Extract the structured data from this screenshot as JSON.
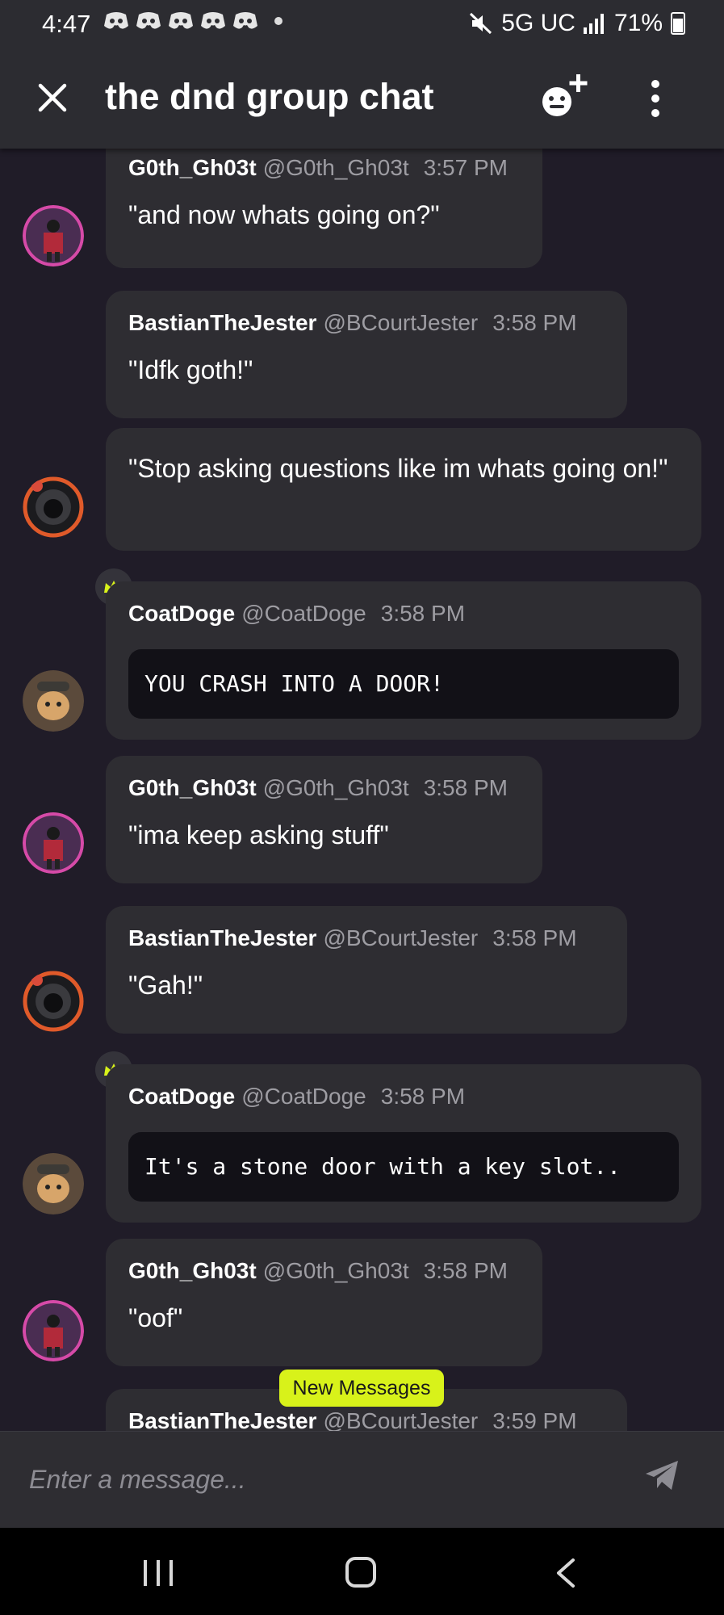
{
  "status_bar": {
    "time": "4:47",
    "network": "5G UC",
    "battery": "71%"
  },
  "header": {
    "title": "the dnd group chat"
  },
  "messages": [
    {
      "name": "G0th_Gh03t",
      "handle": "@G0th_Gh03t",
      "time": "3:57 PM",
      "text": "\"and now whats going on?\""
    },
    {
      "name": "BastianTheJester",
      "handle": "@BCourtJester",
      "time": "3:58 PM",
      "text": "\"Idfk goth!\""
    },
    {
      "text": "\"Stop asking questions like im whats going on!\""
    },
    {
      "name": "CoatDoge",
      "handle": "@CoatDoge",
      "time": "3:58 PM",
      "code": "YOU CRASH INTO A DOOR!"
    },
    {
      "name": "G0th_Gh03t",
      "handle": "@G0th_Gh03t",
      "time": "3:58 PM",
      "text": "\"ima keep asking stuff\""
    },
    {
      "name": "BastianTheJester",
      "handle": "@BCourtJester",
      "time": "3:58 PM",
      "text": "\"Gah!\""
    },
    {
      "name": "CoatDoge",
      "handle": "@CoatDoge",
      "time": "3:58 PM",
      "code": "It's a stone door with a key slot.."
    },
    {
      "name": "G0th_Gh03t",
      "handle": "@G0th_Gh03t",
      "time": "3:58 PM",
      "text": "\"oof\""
    },
    {
      "name": "BastianTheJester",
      "handle": "@BCourtJester",
      "time": "3:59 PM"
    }
  ],
  "new_messages_label": "New Messages",
  "composer": {
    "placeholder": "Enter a message..."
  },
  "colors": {
    "accent": "#d8f21a",
    "background": "#201c28",
    "bubble": "#2e2d32",
    "header": "#2c2c31",
    "code_bg": "#121117"
  }
}
